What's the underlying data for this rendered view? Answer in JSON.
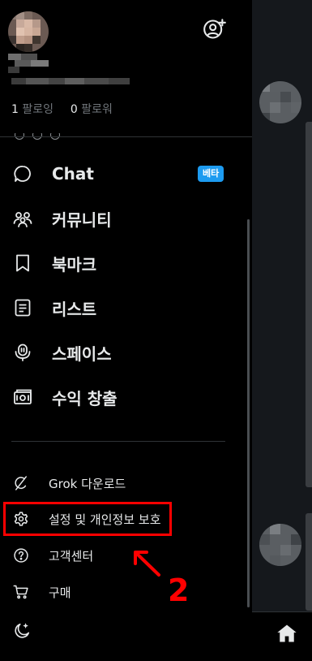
{
  "profile": {
    "following_count": "1",
    "following_label": "팔로잉",
    "followers_count": "0",
    "followers_label": "팔로워"
  },
  "nav": {
    "items": [
      {
        "label": "Chat",
        "icon": "chat-bubble-icon",
        "badge": "베타"
      },
      {
        "label": "커뮤니티",
        "icon": "communities-icon"
      },
      {
        "label": "북마크",
        "icon": "bookmark-icon"
      },
      {
        "label": "리스트",
        "icon": "list-icon"
      },
      {
        "label": "스페이스",
        "icon": "spaces-mic-icon"
      },
      {
        "label": "수익 창출",
        "icon": "monetization-icon"
      }
    ]
  },
  "secondary": {
    "items": [
      {
        "label": "Grok 다운로드",
        "icon": "grok-icon"
      },
      {
        "label": "설정 및 개인정보 보호",
        "icon": "gear-icon"
      },
      {
        "label": "고객센터",
        "icon": "help-icon"
      },
      {
        "label": "구매",
        "icon": "cart-icon"
      }
    ]
  },
  "annotation": {
    "step_number": "2",
    "color": "#ff0000"
  },
  "colors": {
    "background": "#000000",
    "text": "#e7e9ea",
    "muted": "#71767b",
    "badge": "#1d9bf0"
  }
}
